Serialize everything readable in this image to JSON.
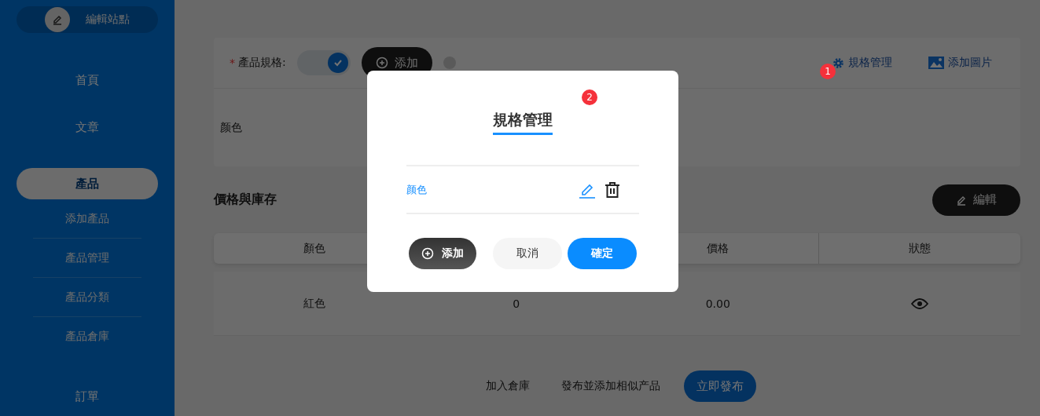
{
  "sidebar": {
    "site_button": "編輯站點",
    "items": [
      {
        "label": "首頁",
        "selected": false
      },
      {
        "label": "文章",
        "selected": false
      },
      {
        "label": "產品",
        "selected": true,
        "children": [
          {
            "label": "添加產品"
          },
          {
            "label": "產品管理"
          },
          {
            "label": "產品分類"
          },
          {
            "label": "產品倉庫"
          }
        ]
      },
      {
        "label": "訂單",
        "selected": false
      }
    ]
  },
  "spec": {
    "label": "產品規格:",
    "required_mark": "*",
    "toggle_on": true,
    "add_button": "添加",
    "manage_link": "規格管理",
    "add_image_link": "添加圖片",
    "rows": [
      "颜色"
    ]
  },
  "price_stock": {
    "title": "價格與庫存",
    "edit_button": "編輯",
    "columns": [
      "顏色",
      "價格",
      "狀態"
    ],
    "rows": [
      {
        "variant": "紅色",
        "stock": "0",
        "price": "0.00",
        "visible": true
      }
    ]
  },
  "footer": {
    "buttons": [
      "加入倉庫",
      "發布並添加相似产品"
    ],
    "primary": "立即發布"
  },
  "badges": [
    "1",
    "2"
  ],
  "modal": {
    "title": "規格管理",
    "items": [
      {
        "name": "颜色"
      }
    ],
    "add_button": "添加",
    "cancel_button": "取消",
    "confirm_button": "確定"
  }
}
